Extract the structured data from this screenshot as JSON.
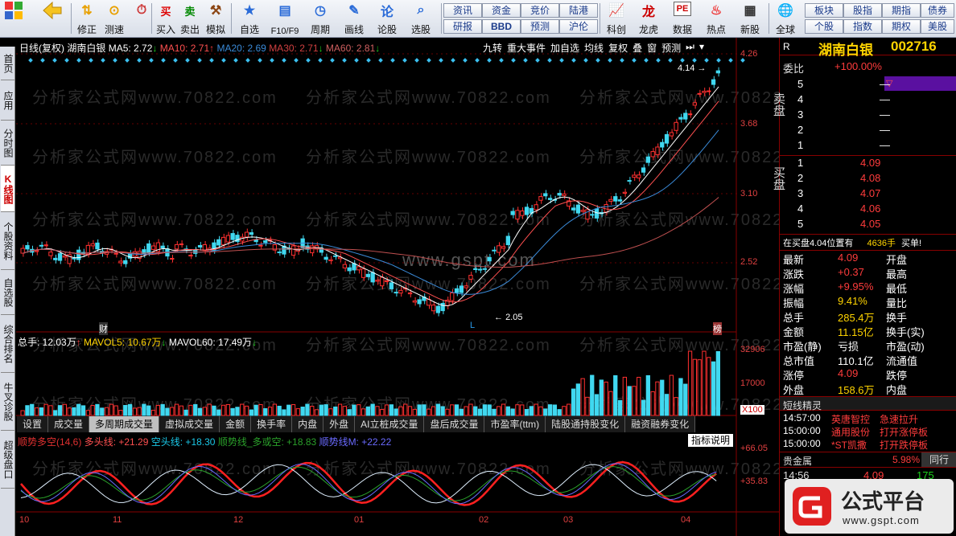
{
  "toolbar": {
    "items": [
      {
        "label": "",
        "icon": "windows-grid-icon"
      },
      {
        "label": "",
        "icon": "back-arrow-icon"
      },
      {
        "label": "修正",
        "icon": "up-down-arrows-icon"
      },
      {
        "label": "测速",
        "icon": "speed-test-icon"
      },
      {
        "label": "买入",
        "icon": "buy-icon"
      },
      {
        "label": "卖出",
        "icon": "sell-icon"
      },
      {
        "label": "模拟",
        "icon": "gavel-icon"
      },
      {
        "label": "自选",
        "icon": "star-icon"
      },
      {
        "label": "F10/F9",
        "icon": "f10-icon"
      },
      {
        "label": "周期",
        "icon": "clock-icon"
      },
      {
        "label": "画线",
        "icon": "pencil-icon"
      },
      {
        "label": "论股",
        "icon": "forum-icon"
      },
      {
        "label": "选股",
        "icon": "stock-select-icon"
      },
      {
        "label": "科创",
        "icon": "science-board-icon"
      },
      {
        "label": "龙虎",
        "icon": "dragon-tiger-icon"
      },
      {
        "label": "数据",
        "icon": "pe-data-icon"
      },
      {
        "label": "热点",
        "icon": "hot-spot-icon"
      },
      {
        "label": "新股",
        "icon": "new-stock-icon"
      },
      {
        "label": "全球",
        "icon": "globe-icon"
      }
    ],
    "small_buttons": [
      "资讯",
      "资金",
      "竞价",
      "陆港",
      "研报",
      "BBD",
      "预测",
      "沪伦",
      "板块",
      "股指",
      "期指",
      "债券",
      "个股",
      "指数",
      "期权",
      "美股"
    ]
  },
  "sidebar": [
    "首页",
    "应用",
    "分时图",
    "K线图",
    "个股资料",
    "自选股",
    "综合排名",
    "牛叉诊股",
    "超级盘口"
  ],
  "chart": {
    "header": {
      "period": "日线(复权)",
      "name": "湖南白银",
      "ma5": "MA5: 2.72",
      "ma10": "MA10: 2.71",
      "ma20": "MA20: 2.69",
      "ma30": "MA30: 2.71",
      "ma60": "MA60: 2.81"
    },
    "header_buttons": [
      "九转",
      "重大事件",
      "加自选",
      "均线",
      "复权",
      "叠",
      "窗",
      "预测"
    ],
    "y_labels": [
      "4.26",
      "3.68",
      "3.10",
      "2.52"
    ],
    "high_label": "4.14",
    "low_label": "2.05",
    "marker_cai": "财",
    "marker_bang": "榜",
    "marker_L": "L",
    "volume": {
      "header_vol": "总手: 12.03万",
      "mavol5": "MAVOL5: 10.67万",
      "mavol60": "MAVOL60: 17.49万",
      "y_labels": [
        "32906",
        "17000",
        "X100"
      ]
    },
    "tabs": [
      "设置",
      "成交量",
      "多周期成交量",
      "虚拟成交量",
      "金额",
      "换手率",
      "内盘",
      "外盘",
      "AI立桩成交量",
      "盘后成交量",
      "市盈率(ttm)",
      "陆股通持股变化",
      "融资融券变化"
    ],
    "active_tab": "多周期成交量",
    "indicator": {
      "title": "顺势多空(14,6)",
      "duo": "多头线: +21.29",
      "kong": "空头线: +18.30",
      "shun": "顺势线_多或空: +18.83",
      "shunm": "顺势线M: +22.22",
      "button": "指标说明",
      "y_labels": [
        "+66.05",
        "+35.83"
      ]
    },
    "x_labels": [
      "10",
      "11",
      "12",
      "01",
      "02",
      "03",
      "04"
    ],
    "watermark": "分析家公式网www.70822.com"
  },
  "quote": {
    "code_header": "R",
    "name": "湖南白银",
    "code": "002716",
    "weibi_label": "委比",
    "weibi": "+100.00%",
    "sell_label": "卖盘",
    "buy_label": "买盘",
    "sell": [
      {
        "n": "5",
        "p": "",
        "v": "—"
      },
      {
        "n": "4",
        "p": "",
        "v": "—"
      },
      {
        "n": "3",
        "p": "",
        "v": "—"
      },
      {
        "n": "2",
        "p": "",
        "v": "—"
      },
      {
        "n": "1",
        "p": "",
        "v": "—"
      }
    ],
    "buy": [
      {
        "n": "1",
        "p": "4.09",
        "v": ""
      },
      {
        "n": "2",
        "p": "4.08",
        "v": ""
      },
      {
        "n": "3",
        "p": "4.07",
        "v": ""
      },
      {
        "n": "4",
        "p": "4.06",
        "v": ""
      },
      {
        "n": "5",
        "p": "4.05",
        "v": ""
      }
    ],
    "buy_note": "在买盘4.04位置有",
    "buy_note_vol": "4636手",
    "buy_note_tail": "买单!",
    "rows": [
      {
        "l": "最新",
        "v": "4.09",
        "r": "开盘",
        "c": "red"
      },
      {
        "l": "涨跌",
        "v": "+0.37",
        "r": "最高",
        "c": "red"
      },
      {
        "l": "涨幅",
        "v": "+9.95%",
        "r": "最低",
        "c": "red"
      },
      {
        "l": "振幅",
        "v": "9.41%",
        "r": "量比",
        "c": "yel"
      },
      {
        "l": "总手",
        "v": "285.4万",
        "r": "换手",
        "c": "yel"
      },
      {
        "l": "金额",
        "v": "11.15亿",
        "r": "换手(实)",
        "c": "yel"
      },
      {
        "l": "市盈(静)",
        "v": "亏损",
        "r": "市盈(动)",
        "c": "wht"
      },
      {
        "l": "总市值",
        "v": "110.1亿",
        "r": "流通值",
        "c": "wht"
      },
      {
        "l": "涨停",
        "v": "4.09",
        "r": "跌停",
        "c": "red"
      },
      {
        "l": "外盘",
        "v": "158.6万",
        "r": "内盘",
        "c": "yel"
      }
    ],
    "sprite_title": "短线精灵",
    "sprites": [
      {
        "t": "14:57:00",
        "n": "英唐智控",
        "e": "急速拉升",
        "c": "red"
      },
      {
        "t": "15:00:00",
        "n": "通用股份",
        "e": "打开涨停板",
        "c": "red"
      },
      {
        "t": "15:00:00",
        "n": "*ST凯撒",
        "e": "打开跌停板",
        "c": "red"
      }
    ],
    "sector": "贵金属",
    "sector_pct": "5.98%",
    "sector_btn": "同行",
    "last_time": "14:56",
    "last_price": "4.09",
    "last_vol": "175"
  },
  "logo": "公式平台",
  "logo_url": "www.gspt.com",
  "watermark2": "www.gspt.com"
}
